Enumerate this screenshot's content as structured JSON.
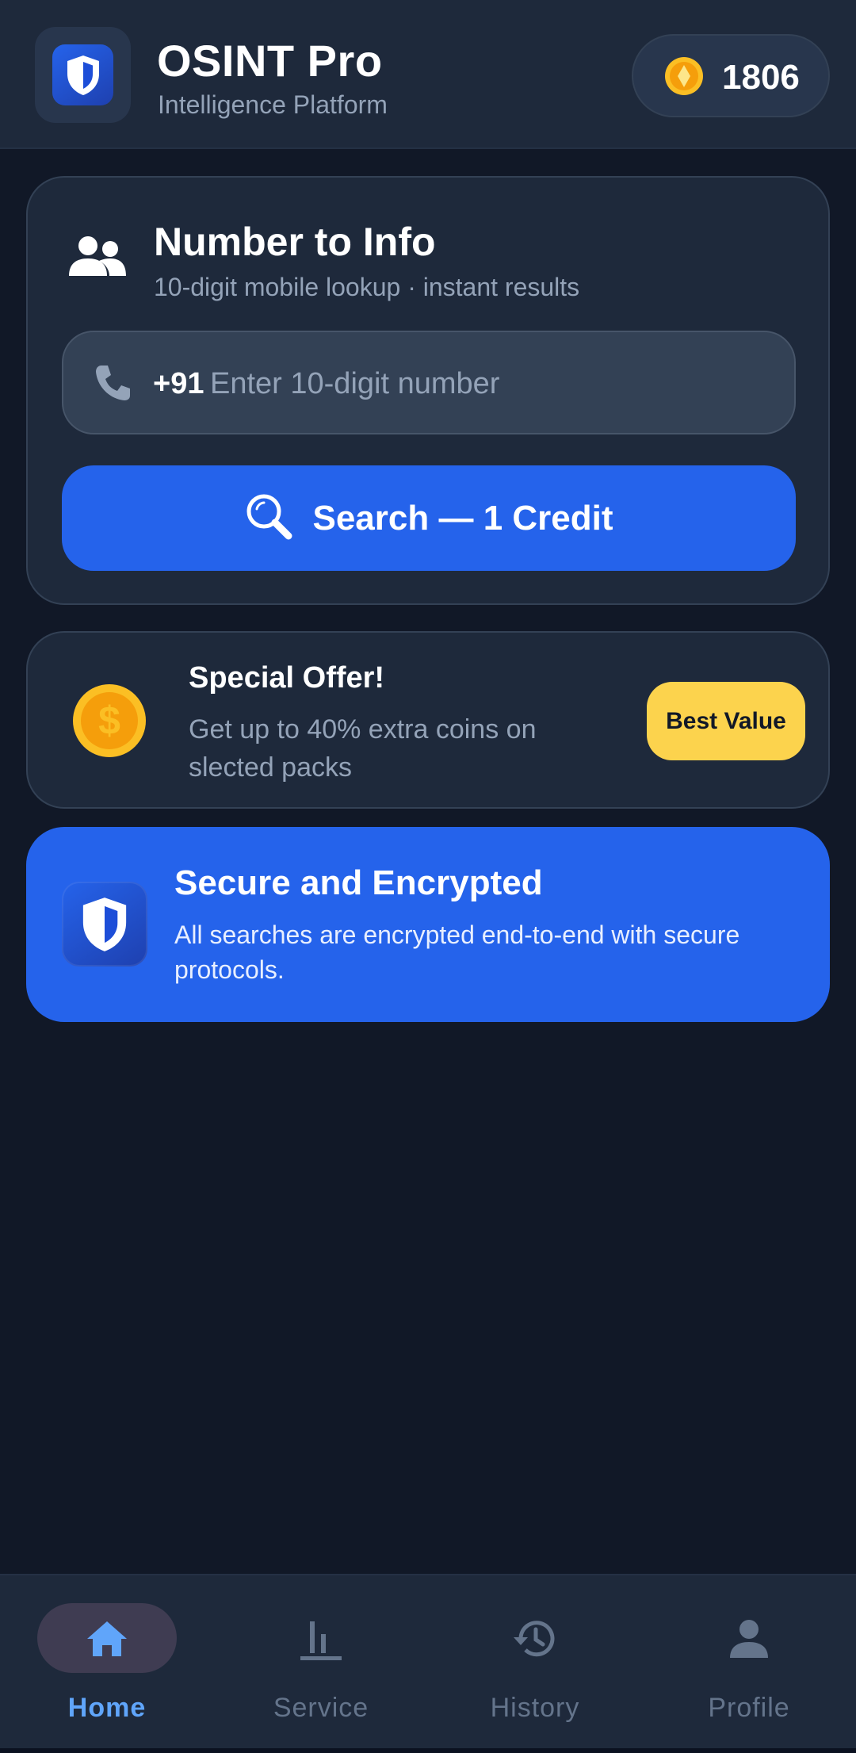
{
  "header": {
    "title": "OSINT Pro",
    "subtitle": "Intelligence Platform",
    "logo_icon": "shield-icon",
    "coins": "1806",
    "coin_icon": "coin-icon"
  },
  "lookup": {
    "title": "Number to Info",
    "subtitle": "10-digit mobile lookup · instant results",
    "country_code": "+91",
    "placeholder": "Enter 10-digit number",
    "value": "",
    "button_label": "Search — 1 Credit"
  },
  "offer": {
    "title": "Special Offer!",
    "text": "Get up to 40% extra coins on slected packs",
    "badge": "Best Value"
  },
  "secure": {
    "title": "Secure and Encrypted",
    "text": "All searches are encrypted end-to-end with secure protocols."
  },
  "nav": {
    "items": [
      {
        "label": "Home",
        "icon": "home-icon",
        "active": true
      },
      {
        "label": "Service",
        "icon": "bar-chart-icon",
        "active": false
      },
      {
        "label": "History",
        "icon": "history-icon",
        "active": false
      },
      {
        "label": "Profile",
        "icon": "person-icon",
        "active": false
      }
    ]
  },
  "colors": {
    "background": "#111827",
    "surface": "#1e293b",
    "accent": "#2563eb",
    "active_nav": "#60a5fa",
    "badge": "#fcd34d",
    "coin": "#fbbf24"
  }
}
